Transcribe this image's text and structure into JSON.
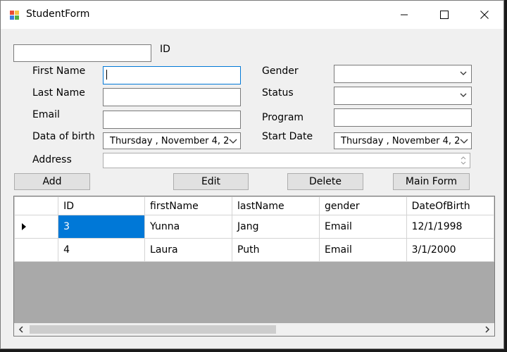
{
  "window": {
    "title": "StudentForm",
    "controls": {
      "minimize": "–",
      "maximize": "☐",
      "close": "✕"
    }
  },
  "form": {
    "id_label": "ID",
    "id_value": "",
    "labels": {
      "first_name": "First Name",
      "last_name": "Last Name",
      "email": "Email",
      "date_of_birth": "Data of birth",
      "address": "Address",
      "gender": "Gender",
      "status": "Status",
      "program": "Program",
      "start_date": "Start Date"
    },
    "values": {
      "first_name": "",
      "last_name": "",
      "email": "",
      "address": "",
      "gender": "",
      "status": "",
      "program": "",
      "date_of_birth": "Thursday  , November   4, 2",
      "start_date": "Thursday  , November   4, 2"
    }
  },
  "buttons": {
    "add": "Add",
    "edit": "Edit",
    "delete": "Delete",
    "main_form": "Main Form"
  },
  "grid": {
    "columns": [
      "ID",
      "firstName",
      "lastName",
      "gender",
      "DateOfBirth"
    ],
    "rows": [
      [
        "3",
        "Yunna",
        "Jang",
        "Email",
        "12/1/1998"
      ],
      [
        "4",
        "Laura",
        "Puth",
        "Email",
        "3/1/2000"
      ]
    ]
  },
  "colors": {
    "selection": "#0078d7",
    "window_bg": "#f0f0f0",
    "grid_bg": "#a9a9a9"
  }
}
